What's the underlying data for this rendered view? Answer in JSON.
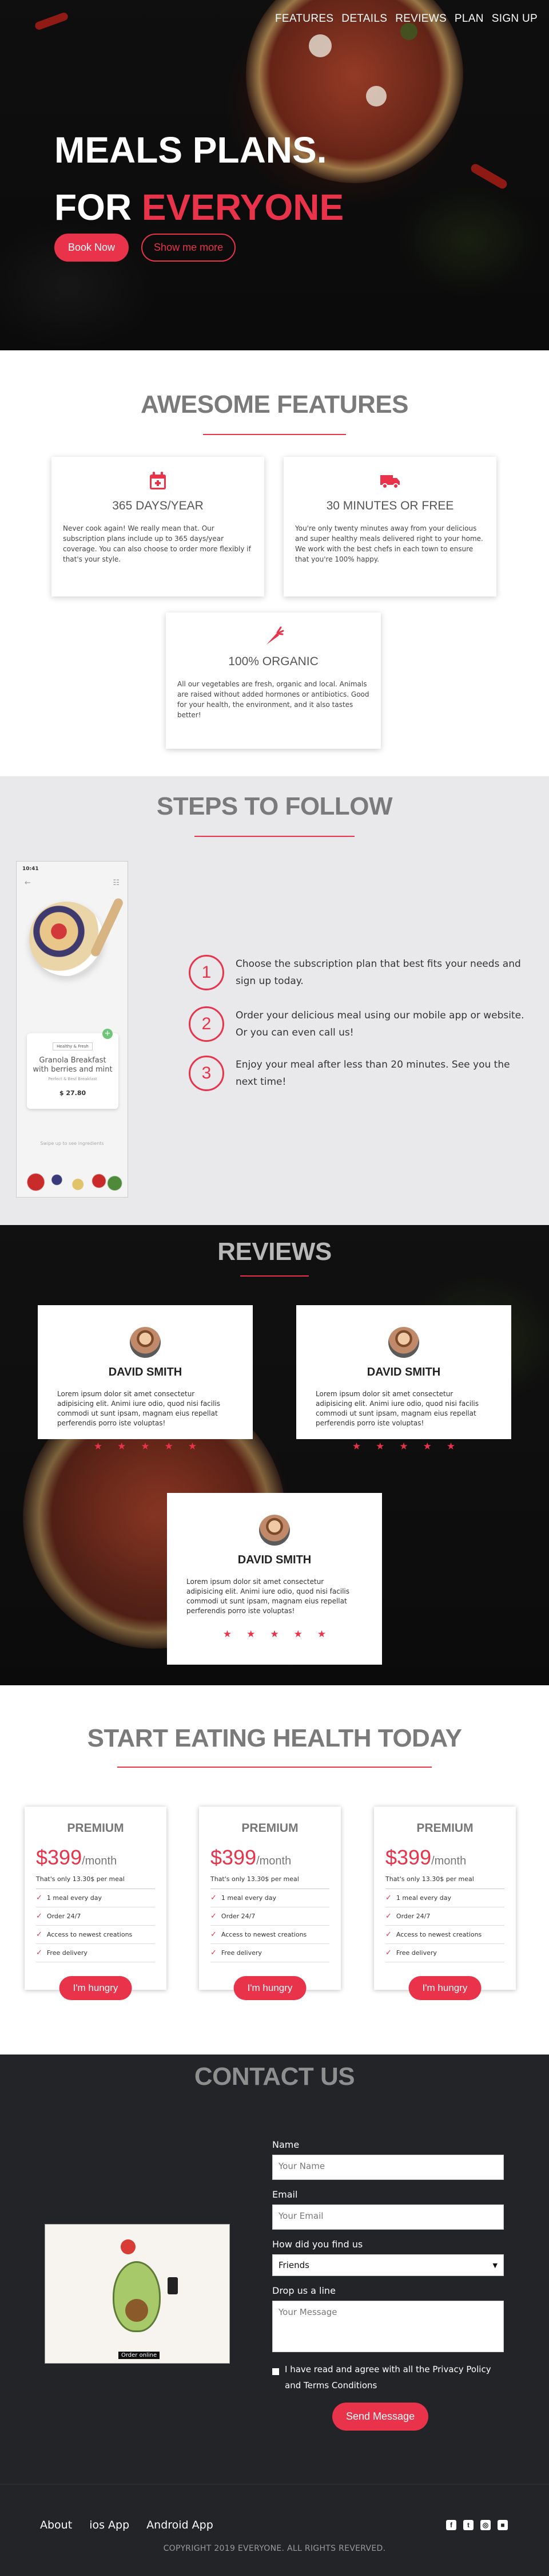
{
  "nav": {
    "items": [
      "FEATURES",
      "DETAILS",
      "REVIEWS",
      "PLAN",
      "SIGN UP"
    ]
  },
  "hero": {
    "line1": "MEALS PLANS.",
    "line2_prefix": "FOR ",
    "line2_accent": "EVERYONE",
    "btn_primary": "Book Now",
    "btn_secondary": "Show me more"
  },
  "features": {
    "title": "AWESOME FEATURES",
    "cards": [
      {
        "icon": "calendar-icon",
        "title": "365 DAYS/YEAR",
        "text": "Never cook again! We really mean that. Our subscription plans include up to 365 days/year coverage. You can also choose to order more flexibly if that's your style."
      },
      {
        "icon": "truck-icon",
        "title": "30 MINUTES OR FREE",
        "text": "You're only twenty minutes away from your delicious and super healthy meals delivered right to your home. We work with the best chefs in each town to ensure that you're 100% happy."
      },
      {
        "icon": "carrot-icon",
        "title": "100% ORGANIC",
        "text": "All our vegetables are fresh, organic and local. Animals are raised without added hormones or antibiotics. Good for your health, the environment, and it also tastes better!"
      }
    ]
  },
  "steps": {
    "title": "STEPS TO FOLLOW",
    "items": [
      {
        "num": "1",
        "text": "Choose the subscription plan that best fits your needs and sign up today."
      },
      {
        "num": "2",
        "text": "Order your delicious meal using our mobile app or website. Or you can even call us!"
      },
      {
        "num": "3",
        "text": "Enjoy your meal after less than 20 minutes. See you the next time!"
      }
    ],
    "phone": {
      "time": "10:41",
      "badge": "Healthy & Fresh",
      "product": "Granola Breakfast with berries and mint",
      "sub": "Perfect & Best Breakfast",
      "price": "$ 27.80",
      "footer": "Swipe up to see ingredients"
    }
  },
  "reviews": {
    "title": "REVIEWS",
    "items": [
      {
        "name": "DAVID SMITH",
        "text": "Lorem ipsum dolor sit amet consectetur adipisicing elit. Animi iure odio, quod nisi facilis commodi ut sunt ipsam, magnam eius repellat perferendis porro iste voluptas!",
        "rating": 5
      },
      {
        "name": "DAVID SMITH",
        "text": "Lorem ipsum dolor sit amet consectetur adipisicing elit. Animi iure odio, quod nisi facilis commodi ut sunt ipsam, magnam eius repellat perferendis porro iste voluptas!",
        "rating": 5
      },
      {
        "name": "DAVID SMITH",
        "text": "Lorem ipsum dolor sit amet consectetur adipisicing elit. Animi iure odio, quod nisi facilis commodi ut sunt ipsam, magnam eius repellat perferendis porro iste voluptas!",
        "rating": 5
      }
    ]
  },
  "pricing": {
    "title": "START EATING HEALTH TODAY",
    "plans": [
      {
        "name": "PREMIUM",
        "price": "$399",
        "period": "/month",
        "note": "That's only 13.30$ per meal",
        "features": [
          "1 meal every day",
          "Order 24/7",
          "Access to newest creations",
          "Free delivery"
        ],
        "button": "I'm hungry"
      },
      {
        "name": "PREMIUM",
        "price": "$399",
        "period": "/month",
        "note": "That's only 13.30$ per meal",
        "features": [
          "1 meal every day",
          "Order 24/7",
          "Access to newest creations",
          "Free delivery"
        ],
        "button": "I'm hungry"
      },
      {
        "name": "PREMIUM",
        "price": "$399",
        "period": "/month",
        "note": "That's only 13.30$ per meal",
        "features": [
          "1 meal every day",
          "Order 24/7",
          "Access to newest creations",
          "Free delivery"
        ],
        "button": "I'm hungry"
      }
    ]
  },
  "contact": {
    "title": "CONTACT US",
    "name_label": "Name",
    "name_placeholder": "Your Name",
    "email_label": "Email",
    "email_placeholder": "Your Email",
    "find_label": "How did you find us",
    "find_value": "Friends",
    "message_label": "Drop us a line",
    "message_placeholder": "Your Message",
    "agree_text": "I have read and agree with all the Privacy Policy and Terms Conditions",
    "send": "Send Message",
    "illustration_caption": "Order online"
  },
  "footer": {
    "links": [
      "About",
      "ios App",
      "Android App"
    ],
    "social": [
      "facebook-icon",
      "twitter-icon",
      "instagram-icon",
      "other-icon"
    ],
    "copyright": "COPYRIGHT 2019 EVERYONE. ALL RIGHTS REVERVED."
  },
  "colors": {
    "accent": "#e8334a",
    "dark": "#232427",
    "steps_bg": "#e9e9eb"
  }
}
